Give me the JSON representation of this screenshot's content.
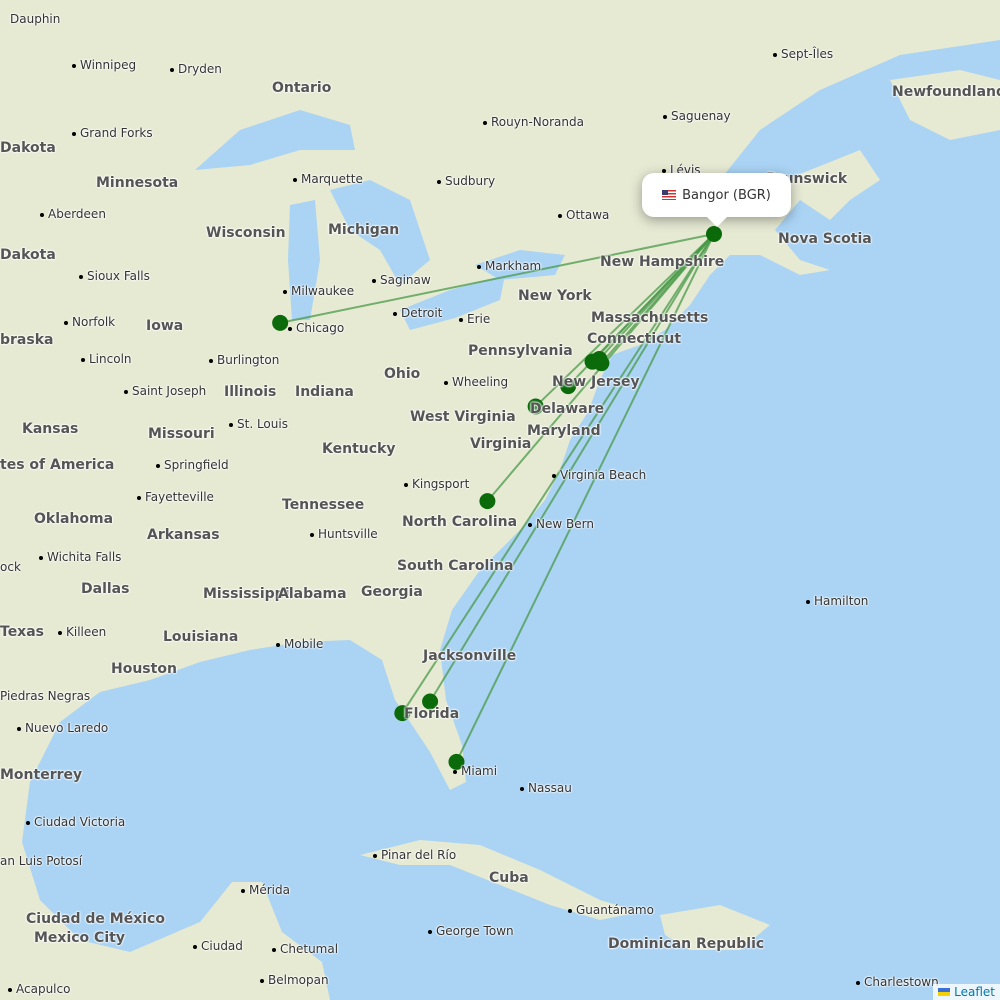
{
  "map": {
    "ocean_color": "#aad3f4",
    "land_color": "#e6ead3",
    "route_color": "#4a9a4a",
    "marker_color": "#0b6b0b",
    "airports": [
      {
        "name": "Bangor (BGR)",
        "lat": 44.81,
        "lon": -68.83,
        "selected": true
      },
      {
        "name": "Chicago",
        "lat": 41.97,
        "lon": -87.9
      },
      {
        "name": "New York 1",
        "lat": 40.69,
        "lon": -74.17
      },
      {
        "name": "New York 2",
        "lat": 40.78,
        "lon": -73.87
      },
      {
        "name": "New York 3",
        "lat": 40.64,
        "lon": -73.78
      },
      {
        "name": "Philadelphia",
        "lat": 39.87,
        "lon": -75.24
      },
      {
        "name": "Baltimore",
        "lat": 39.18,
        "lon": -76.67
      },
      {
        "name": "Raleigh",
        "lat": 35.88,
        "lon": -78.79
      },
      {
        "name": "Orlando",
        "lat": 28.43,
        "lon": -81.31
      },
      {
        "name": "Tampa",
        "lat": 27.98,
        "lon": -82.53
      },
      {
        "name": "Fort Lauderdale",
        "lat": 26.07,
        "lon": -80.15
      }
    ]
  },
  "popup": {
    "flag": "us-flag-icon",
    "text": "Bangor (BGR)"
  },
  "labels": [
    "Dauphin",
    "Winnipeg",
    "Dryden",
    "Ontario",
    "Rouyn-Noranda",
    "Saguenay",
    "Sept-Îles",
    "Newfoundland and",
    "Dakota",
    "Grand Forks",
    "Minnesota",
    "Marquette",
    "Sudbury",
    "Lévis",
    "Brunswick",
    "Aberdeen",
    "Wisconsin",
    "Michigan",
    "Ottawa",
    "Nova Scotia",
    "Dakota",
    "Sioux Falls",
    "Saginaw",
    "Markham",
    "New Hampshire",
    "Milwaukee",
    "New York",
    "Norfolk",
    "Iowa",
    "Chicago",
    "Detroit",
    "Erie",
    "Massachusetts",
    "braska",
    "Connecticut",
    "Lincoln",
    "Burlington",
    "Pennsylvania",
    "Ohio",
    "Saint Joseph",
    "Illinois",
    "Indiana",
    "Wheeling",
    "New Jersey",
    "West Virginia",
    "Delaware",
    "Kansas",
    "Missouri",
    "St. Louis",
    "Maryland",
    "Virginia",
    "tes of America",
    "Springfield",
    "Kentucky",
    "Virginia Beach",
    "Fayetteville",
    "Kingsport",
    "Tennessee",
    "Oklahoma",
    "Arkansas",
    "North Carolina",
    "New Bern",
    "Huntsville",
    "South Carolina",
    "Wichita Falls",
    "ock",
    "Dallas",
    "Mississippi",
    "Alabama",
    "Georgia",
    "Hamilton",
    "Texas",
    "Killeen",
    "Louisiana",
    "Mobile",
    "Jacksonville",
    "Houston",
    "Piedras Negras",
    "Florida",
    "Nuevo Laredo",
    "Miami",
    "Monterrey",
    "Nassau",
    "Ciudad Victoria",
    "Pinar del Río",
    "Cuba",
    "an Luis Potosí",
    "Mérida",
    "Guantánamo",
    "Ciudad de México",
    "Mexico City",
    "Ciudad",
    "Chetumal",
    "George Town",
    "Dominican Republic",
    "Belmopan",
    "Acapulco",
    "Charlestown"
  ],
  "attribution": {
    "flag": "ukraine-flag-icon",
    "text": "Leaflet"
  }
}
